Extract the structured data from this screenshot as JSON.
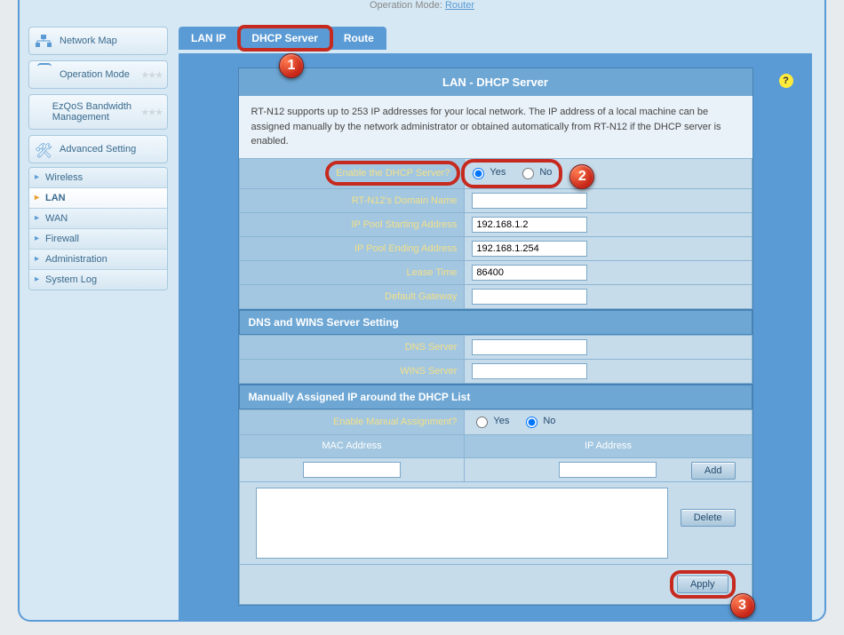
{
  "topbar": {
    "label": "Operation Mode:",
    "value": "Router"
  },
  "sidebar": {
    "main": [
      {
        "label": "Network Map"
      },
      {
        "label": "Operation Mode"
      },
      {
        "label": "EzQoS Bandwidth Management"
      },
      {
        "label": "Advanced Setting"
      }
    ],
    "sub": [
      {
        "label": "Wireless"
      },
      {
        "label": "LAN"
      },
      {
        "label": "WAN"
      },
      {
        "label": "Firewall"
      },
      {
        "label": "Administration"
      },
      {
        "label": "System Log"
      }
    ]
  },
  "tabs": [
    {
      "label": "LAN IP"
    },
    {
      "label": "DHCP Server"
    },
    {
      "label": "Route"
    }
  ],
  "panel": {
    "title": "LAN - DHCP Server",
    "desc": "RT-N12 supports up to 253 IP addresses for your local network. The IP address of a local machine can be assigned manually by the network administrator or obtained automatically from RT-N12 if the DHCP server is enabled.",
    "fields": {
      "enable_label": "Enable the DHCP Server?",
      "yes": "Yes",
      "no": "No",
      "domain_label": "RT-N12's Domain Name",
      "domain_value": "",
      "pool_start_label": "IP Pool Starting Address",
      "pool_start_value": "192.168.1.2",
      "pool_end_label": "IP Pool Ending Address",
      "pool_end_value": "192.168.1.254",
      "lease_label": "Lease Time",
      "lease_value": "86400",
      "gateway_label": "Default Gateway",
      "gateway_value": ""
    },
    "dns_section": {
      "header": "DNS and WINS Server Setting",
      "dns_label": "DNS Server",
      "dns_value": "",
      "wins_label": "WINS Server",
      "wins_value": ""
    },
    "manual_section": {
      "header": "Manually Assigned IP around the DHCP List",
      "enable_label": "Enable Manual Assignment?",
      "yes": "Yes",
      "no": "No",
      "mac_col": "MAC Address",
      "ip_col": "IP Address",
      "add": "Add",
      "delete": "Delete"
    },
    "apply": "Apply"
  },
  "badges": {
    "one": "1",
    "two": "2",
    "three": "3"
  }
}
